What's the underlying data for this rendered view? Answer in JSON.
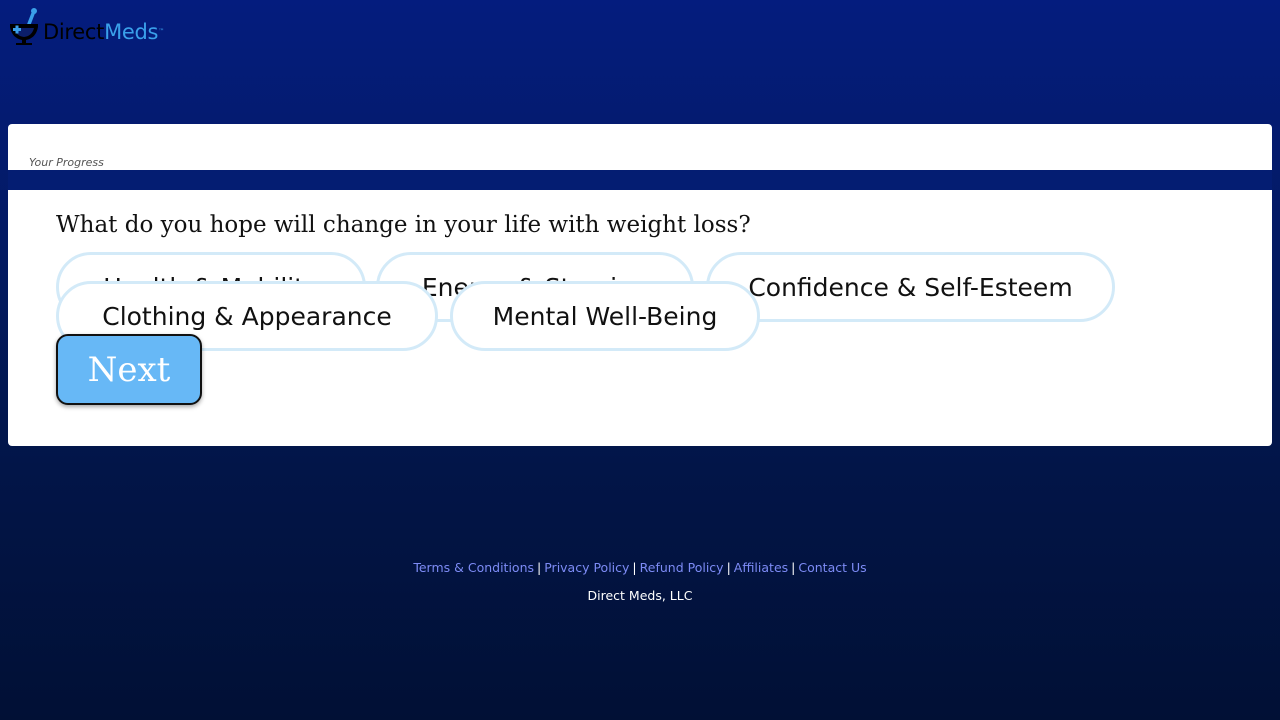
{
  "brand": {
    "name_part1": "Direct",
    "name_part2": "Meds",
    "trademark": "™",
    "color_primary": "#3aa0ea",
    "color_dark": "#000000"
  },
  "progress": {
    "label": "Your Progress",
    "value": 0
  },
  "question": {
    "text": "What do you hope will change in your life with weight loss?",
    "options": [
      {
        "label": "Health & Mobility"
      },
      {
        "label": "Energy & Stamina"
      },
      {
        "label": "Confidence & Self-Esteem"
      },
      {
        "label": "Clothing & Appearance"
      },
      {
        "label": "Mental Well-Being"
      }
    ],
    "next_label": "Next"
  },
  "footer": {
    "links": [
      {
        "label": "Terms & Conditions"
      },
      {
        "label": "Privacy Policy"
      },
      {
        "label": "Refund Policy"
      },
      {
        "label": "Affiliates"
      },
      {
        "label": "Contact Us"
      }
    ],
    "separator": "|",
    "company": "Direct Meds, LLC"
  },
  "colors": {
    "background_top": "#041c7e",
    "background_bottom": "#011035",
    "option_border": "#d3eaf8",
    "next_button": "#67b8f6",
    "footer_link": "#7d8bf5"
  }
}
